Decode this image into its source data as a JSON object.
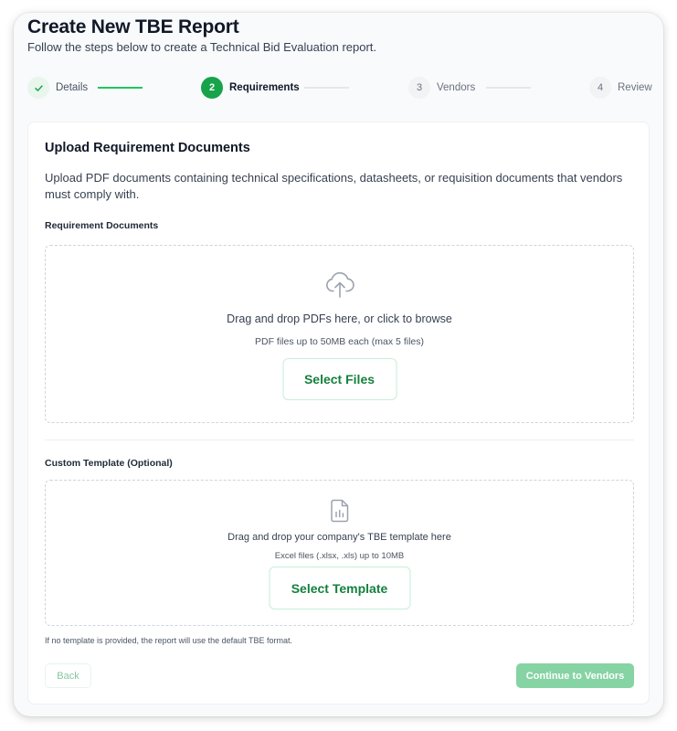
{
  "header": {
    "title": "Create New TBE Report",
    "subtitle": "Follow the steps below to create a Technical Bid Evaluation report."
  },
  "stepper": {
    "steps": [
      {
        "number": "",
        "label": "Details",
        "state": "done",
        "icon": "check-icon"
      },
      {
        "number": "2",
        "label": "Requirements",
        "state": "active"
      },
      {
        "number": "3",
        "label": "Vendors",
        "state": "pending"
      },
      {
        "number": "4",
        "label": "Review",
        "state": "pending"
      }
    ]
  },
  "main": {
    "section_title": "Upload Requirement Documents",
    "section_description": "Upload PDF documents containing technical specifications, datasheets, or requisition documents that vendors must comply with.",
    "requirement_docs": {
      "label": "Requirement Documents",
      "icon": "cloud-upload-icon",
      "instruction": "Drag and drop PDFs here, or click to browse",
      "hint": "PDF files up to 50MB each (max 5 files)",
      "button_label": "Select Files"
    },
    "custom_template": {
      "label": "Custom Template (Optional)",
      "icon": "spreadsheet-file-icon",
      "instruction": "Drag and drop your company's TBE template here",
      "hint": "Excel files (.xlsx, .xls) up to 10MB",
      "button_label": "Select Template"
    },
    "template_note": "If no template is provided, the report will use the default TBE format."
  },
  "footer": {
    "back_label": "Back",
    "continue_label": "Continue to Vendors"
  },
  "colors": {
    "accent": "#16a34a",
    "accent_light": "#86d3a3",
    "button_text": "#15803d"
  }
}
